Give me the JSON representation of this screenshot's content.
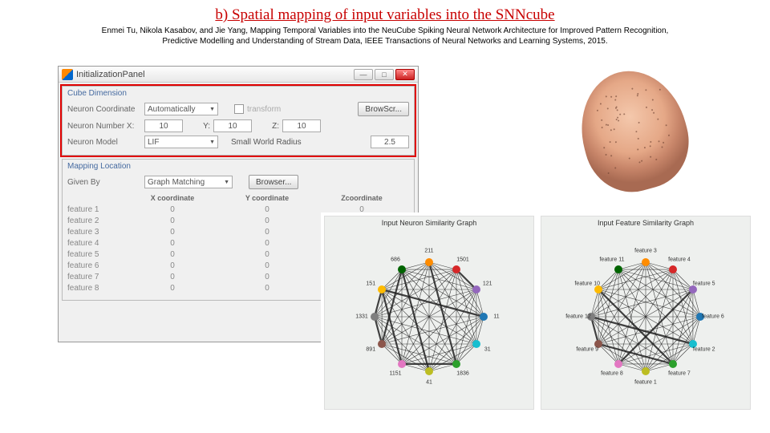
{
  "title": "b) Spatial mapping of input variables into the SNNcube",
  "citation": "Enmei Tu, Nikola Kasabov, and Jie Yang, Mapping Temporal Variables into the NeuCube Spiking Neural Network Architecture for Improved Pattern Recognition, Predictive Modelling and Understanding of Stream Data, IEEE Transactions of Neural Networks and Learning Systems, 2015.",
  "window": {
    "title": "InitializationPanel",
    "btn_min": "—",
    "btn_max": "□",
    "btn_close": "✕"
  },
  "cube": {
    "group": "Cube Dimension",
    "coord_lbl": "Neuron Coordinate",
    "coord_val": "Automatically",
    "transform_lbl": "transform",
    "browse": "BrowScr...",
    "num_lbl": "Neuron Number   X:",
    "x": "10",
    "y_lbl": "Y:",
    "y": "10",
    "z_lbl": "Z:",
    "z": "10",
    "model_lbl": "Neuron Model",
    "model_val": "LIF",
    "swr_lbl": "Small World Radius",
    "swr_val": "2.5"
  },
  "map": {
    "group": "Mapping Location",
    "given_lbl": "Given By",
    "given_val": "Graph Matching",
    "browser": "Browser...",
    "col1": "X coordinate",
    "col2": "Y coordinate",
    "col3": "Zcoordinate",
    "features": [
      "feature 1",
      "feature 2",
      "feature 3",
      "feature 4",
      "feature 5",
      "feature 6",
      "feature 7",
      "feature 8"
    ],
    "zero": "0"
  },
  "graphs": {
    "left_title": "Input Neuron Similarity Graph",
    "right_title": "Input Feature Similarity Graph",
    "left_labels": [
      "211",
      "1501",
      "121",
      "11",
      "31",
      "1836",
      "41",
      "1151",
      "891",
      "1331",
      "151",
      "686"
    ],
    "right_labels": [
      "feature 3",
      "feature 4",
      "feature 5",
      "feature 6",
      "feature 2",
      "feature 7",
      "feature 1",
      "feature 8",
      "feature 9",
      "feature 12",
      "feature 10",
      "feature 11"
    ],
    "colors": [
      "#ff8c00",
      "#d62728",
      "#9467bd",
      "#1f77b4",
      "#17becf",
      "#2ca02c",
      "#bcbd22",
      "#e377c2",
      "#8c564b",
      "#7f7f7f",
      "#ffbb00",
      "#006400"
    ]
  }
}
